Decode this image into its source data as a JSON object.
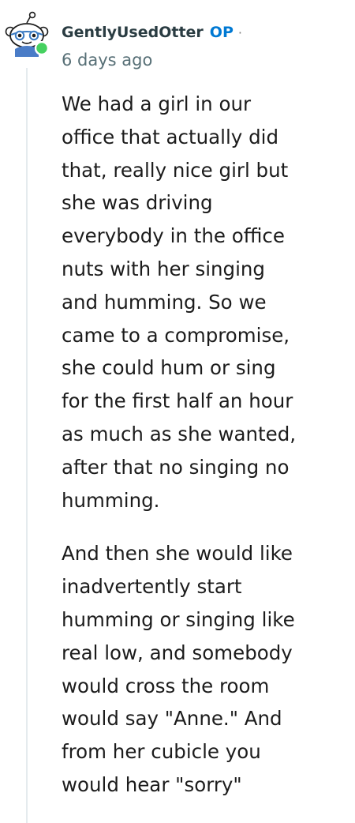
{
  "comment": {
    "username": "GentlyUsedOtter",
    "op_badge": "OP",
    "separator": "·",
    "timestamp": "6 days ago",
    "avatar_icon": "snoo-avatar-icon",
    "online_color": "#46d160",
    "paragraphs": [
      {
        "lines": [
          "We had a girl in our",
          "office that actually did",
          "that, really nice girl but",
          "she was driving",
          "everybody in the office",
          "nuts with her singing",
          "and humming. So we",
          "came to a compromise,",
          "she could hum or sing",
          "for the first half an hour",
          "as much as she wanted,",
          "after that no singing no",
          "humming."
        ]
      },
      {
        "lines": [
          "And then she would like",
          "inadvertently start",
          "humming or singing like",
          "real low, and somebody",
          "would cross the room",
          "would say \"Anne.\" And",
          "from her cubicle you",
          "would hear \"sorry\""
        ]
      }
    ]
  }
}
